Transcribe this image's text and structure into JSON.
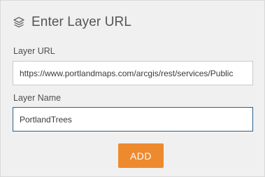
{
  "dialog": {
    "title": "Enter Layer URL",
    "title_icon": "layers-icon"
  },
  "fields": {
    "layer_url": {
      "label": "Layer URL",
      "value": "https://www.portlandmaps.com/arcgis/rest/services/Public"
    },
    "layer_name": {
      "label": "Layer Name",
      "value": "PortlandTrees"
    }
  },
  "actions": {
    "add_label": "ADD"
  },
  "colors": {
    "panel_background": "#f0f0f0",
    "button_accent": "#ee8a2e",
    "focused_border": "#2f5f88"
  }
}
